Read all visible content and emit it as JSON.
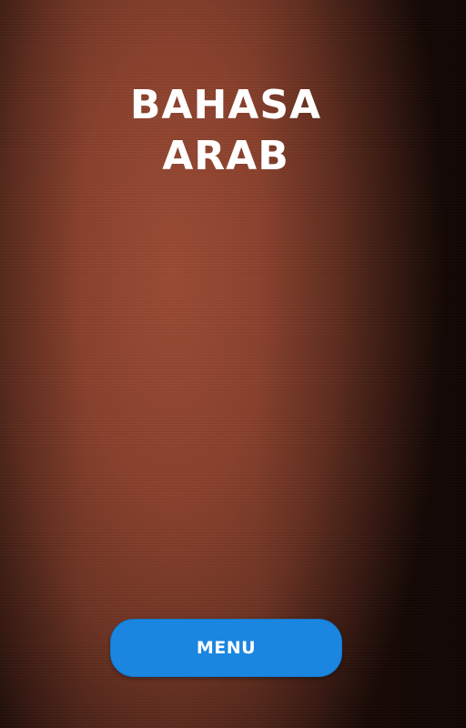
{
  "app": {
    "title_line1": "BAHASA",
    "title_line2": "ARAB"
  },
  "menu_button": {
    "label": "MENU",
    "color": "#1a86e0"
  },
  "theme": {
    "background_accent": "#9a4b35",
    "text_color": "#ffffff"
  }
}
